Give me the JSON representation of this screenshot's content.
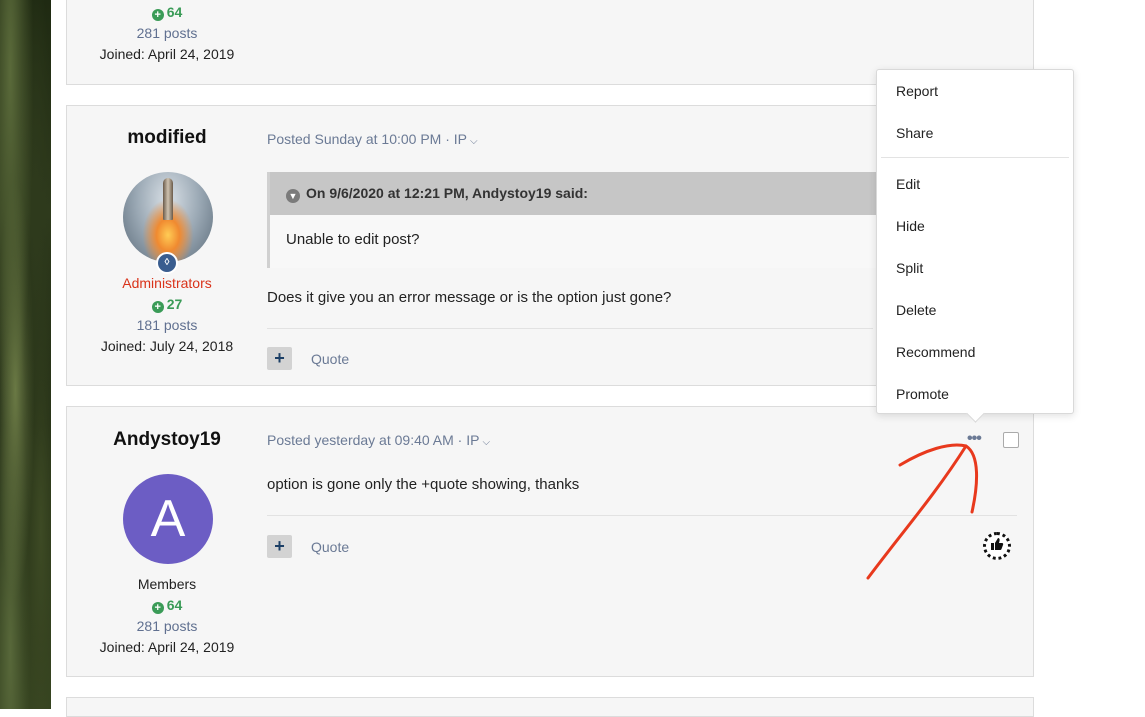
{
  "post_top": {
    "reputation": "64",
    "posts": "281 posts",
    "joined": "Joined: April 24, 2019"
  },
  "post_modified": {
    "author": "modified",
    "group": "Administrators",
    "reputation": "27",
    "posts": "181 posts",
    "joined": "Joined: July 24, 2018",
    "posted": "Posted Sunday at 10:00 PM",
    "ip": "· IP",
    "quote_header": "On 9/6/2020 at 12:21 PM, Andystoy19 said:",
    "quote_body": "Unable to edit post?",
    "body": "Does it give you an error message or is the option just gone?",
    "plus": "+",
    "quote_label": "Quote"
  },
  "post_andystoy": {
    "author": "Andystoy19",
    "avatar_letter": "A",
    "group": "Members",
    "reputation": "64",
    "posts": "281 posts",
    "joined": "Joined: April 24, 2019",
    "posted": "Posted yesterday at 09:40 AM",
    "ip": "· IP",
    "body": "option is gone only the +quote showing, thanks",
    "plus": "+",
    "quote_label": "Quote",
    "dots": "•••",
    "react_icon": "thumbs-up"
  },
  "menu": {
    "items": [
      "Report",
      "Share",
      "Edit",
      "Hide",
      "Split",
      "Delete",
      "Recommend",
      "Promote"
    ]
  },
  "colors": {
    "admin": "#d9331a",
    "reputation": "#3a9b57",
    "avatar_bg": "#6c5dc4",
    "annotation_arrow": "#e8391d"
  }
}
